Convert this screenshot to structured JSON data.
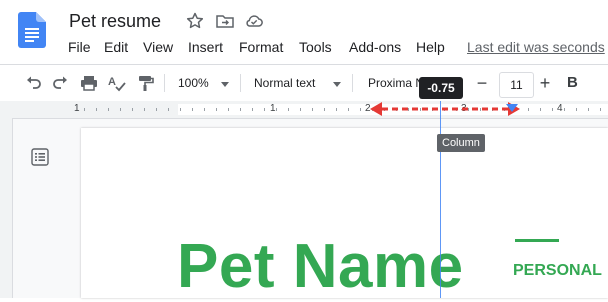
{
  "app": {
    "doc_title": "Pet resume"
  },
  "menu": [
    "File",
    "Edit",
    "View",
    "Insert",
    "Format",
    "Tools",
    "Add-ons",
    "Help"
  ],
  "last_edit": "Last edit was seconds",
  "toolbar": {
    "zoom": "100%",
    "style": "Normal text",
    "font": "Proxima N",
    "font_size": "11",
    "minus": "−",
    "plus": "+",
    "bold": "B"
  },
  "ruler": {
    "numbers": [
      "1",
      "1",
      "2",
      "3",
      "4"
    ]
  },
  "tooltip": {
    "value": "-0.75",
    "label": "Column"
  },
  "document": {
    "heading": "Pet Name",
    "section": "PERSONAL"
  },
  "colors": {
    "accent_green": "#34a853",
    "google_blue": "#4285f4",
    "tooltip_bg": "#202124"
  },
  "icons": [
    "docs-icon",
    "star-icon",
    "move-folder-icon",
    "cloud-icon",
    "undo-icon",
    "redo-icon",
    "print-icon",
    "spellcheck-icon",
    "paint-format-icon",
    "outline-icon"
  ]
}
